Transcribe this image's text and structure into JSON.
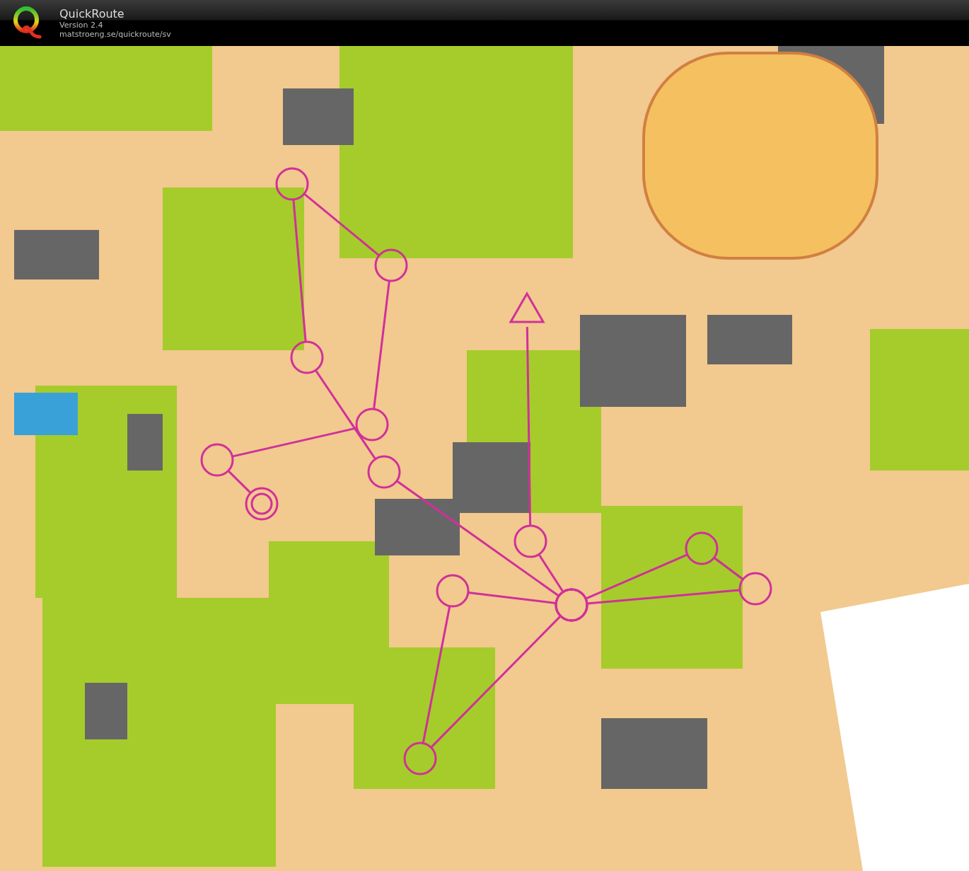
{
  "header": {
    "app_name": "QuickRoute",
    "version": "Version 2.4",
    "url": "matstroeng.se/quickroute/sv"
  }
}
